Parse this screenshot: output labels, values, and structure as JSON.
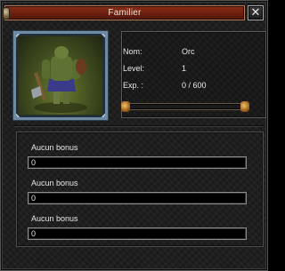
{
  "window": {
    "title": "Familier"
  },
  "pet": {
    "name_label": "Nom:",
    "name_value": "Orc",
    "level_label": "Level:",
    "level_value": "1",
    "exp_label": "Exp. :",
    "exp_value": "0 / 600",
    "exp_fraction": 0
  },
  "bonuses": [
    {
      "label": "Aucun bonus",
      "value": "0"
    },
    {
      "label": "Aucun bonus",
      "value": "0"
    },
    {
      "label": "Aucun bonus",
      "value": "0"
    }
  ],
  "icons": {
    "close": "close-icon",
    "pin": "pin-icon",
    "portrait": "orc-portrait"
  },
  "colors": {
    "title_bar": "#6c1f0f",
    "frame": "#6f8aa3",
    "exp_fill": "#c07a28"
  }
}
